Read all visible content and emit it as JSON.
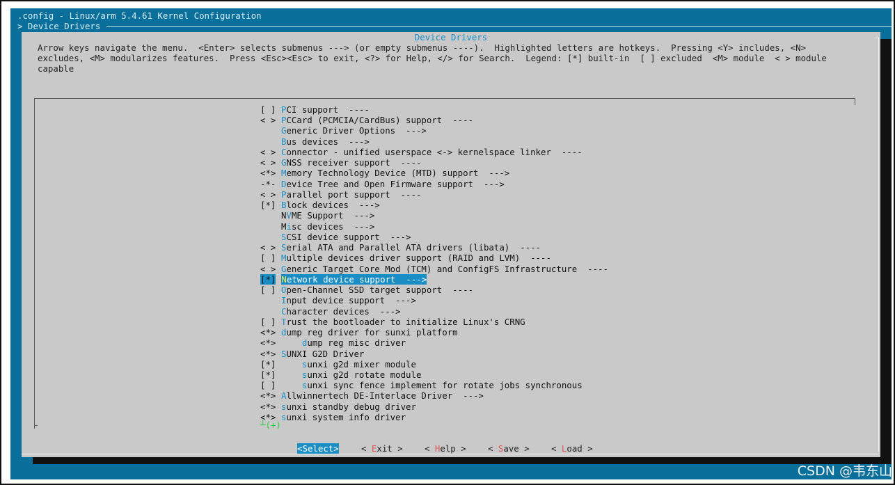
{
  "window": {
    "title_line": ".config - Linux/arm 5.4.61 Kernel Configuration",
    "breadcrumb": "> Device Drivers"
  },
  "dialog": {
    "title": "Device Drivers",
    "help_text": "Arrow keys navigate the menu.  <Enter> selects submenus ---> (or empty submenus ----).  Highlighted letters are hotkeys.  Pressing <Y> includes, <N>\nexcludes, <M> modularizes features.  Press <Esc><Esc> to exit, <?> for Help, </> for Search.  Legend: [*] built-in  [ ] excluded  <M> module  < > module\ncapable"
  },
  "menu": {
    "items": [
      {
        "state": "[ ]",
        "hotkey": "P",
        "rest": "CI support  ----"
      },
      {
        "state": "< >",
        "hotkey": "P",
        "rest": "CCard (PCMCIA/CardBus) support  ----"
      },
      {
        "state": "",
        "hotkey": "G",
        "rest": "eneric Driver Options  --->"
      },
      {
        "state": "",
        "hotkey": "B",
        "rest": "us devices  --->"
      },
      {
        "state": "< >",
        "hotkey": "C",
        "rest": "onnector - unified userspace <-> kernelspace linker  ----"
      },
      {
        "state": "< >",
        "hotkey": "G",
        "rest": "NSS receiver support  ----"
      },
      {
        "state": "<*>",
        "hotkey": "M",
        "rest": "emory Technology Device (MTD) support  --->"
      },
      {
        "state": "-*-",
        "hotkey": "D",
        "rest": "evice Tree and Open Firmware support  --->"
      },
      {
        "state": "< >",
        "hotkey": "P",
        "rest": "arallel port support  ----"
      },
      {
        "state": "[*]",
        "hotkey": "B",
        "rest": "lock devices  --->"
      },
      {
        "state": "",
        "pre": "N",
        "hotkey": "V",
        "rest": "ME Support  --->"
      },
      {
        "state": "",
        "pre": "M",
        "hotkey": "i",
        "rest": "sc devices  --->"
      },
      {
        "state": "",
        "hotkey": "S",
        "rest": "CSI device support  --->"
      },
      {
        "state": "< >",
        "hotkey": "S",
        "rest": "erial ATA and Parallel ATA drivers (libata)  ----"
      },
      {
        "state": "[ ]",
        "hotkey": "M",
        "rest": "ultiple devices driver support (RAID and LVM)  ----"
      },
      {
        "state": "< >",
        "hotkey": "G",
        "rest": "eneric Target Core Mod (TCM) and ConfigFS Infrastructure  ----"
      },
      {
        "state": "[*]",
        "hotkey": "N",
        "rest": "etwork device support  --->",
        "selected": true
      },
      {
        "state": "[ ]",
        "hotkey": "O",
        "rest": "pen-Channel SSD target support  ----"
      },
      {
        "state": "",
        "hotkey": "I",
        "rest": "nput device support  --->"
      },
      {
        "state": "",
        "hotkey": "C",
        "rest": "haracter devices  --->"
      },
      {
        "state": "[ ]",
        "hotkey": "T",
        "rest": "rust the bootloader to initialize Linux's CRNG"
      },
      {
        "state": "<*>",
        "hotkey": "d",
        "rest": "ump reg driver for sunxi platform"
      },
      {
        "state": "<*>",
        "pre": "    ",
        "hotkey": "d",
        "rest": "ump reg misc driver"
      },
      {
        "state": "<*>",
        "hotkey": "S",
        "rest": "UNXI G2D Driver"
      },
      {
        "state": "[*]",
        "pre": "    ",
        "hotkey": "s",
        "rest": "unxi g2d mixer module"
      },
      {
        "state": "[*]",
        "pre": "    ",
        "hotkey": "s",
        "rest": "unxi g2d rotate module"
      },
      {
        "state": "[ ]",
        "pre": "    ",
        "hotkey": "s",
        "rest": "unxi sync fence implement for rotate jobs synchronous"
      },
      {
        "state": "<*>",
        "hotkey": "A",
        "rest": "llwinnertech DE-Interlace Driver  --->"
      },
      {
        "state": "<*>",
        "hotkey": "s",
        "rest": "unxi standby debug driver"
      },
      {
        "state": "<*>",
        "hotkey": "s",
        "rest": "unxi system info driver"
      }
    ],
    "more_indicator": "┴(+)"
  },
  "buttons": {
    "select": {
      "pre": "<",
      "hotkey": "S",
      "rest": "elect>"
    },
    "exit": {
      "pre": "< ",
      "hotkey": "E",
      "rest": "xit >"
    },
    "help": {
      "pre": "< ",
      "hotkey": "H",
      "rest": "elp >"
    },
    "save": {
      "pre": "< ",
      "hotkey": "S",
      "rest": "ave >"
    },
    "load": {
      "pre": "< ",
      "hotkey": "L",
      "rest": "oad >"
    }
  },
  "watermark": "CSDN @韦东山",
  "colors": {
    "background": "#0a6f9b",
    "dialog": "#c9c9c9",
    "accent": "#1a8ec4",
    "selected_hotkey": "#f4e94d",
    "button_hotkey": "#e05555",
    "more_indicator": "#2ecf43"
  }
}
